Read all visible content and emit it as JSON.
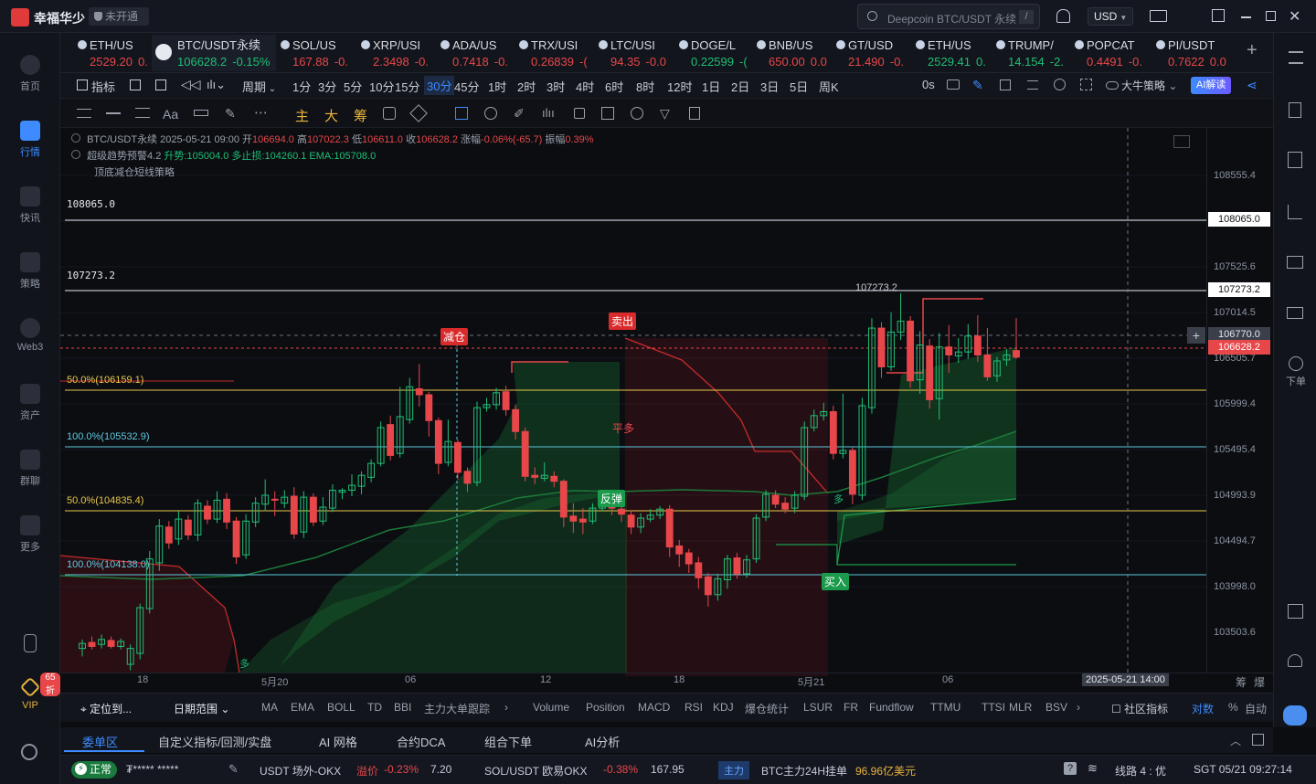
{
  "app": {
    "name": "幸福华少",
    "account_status": "未开通"
  },
  "search": {
    "placeholder": "Deepcoin BTC/USDT 永续"
  },
  "currency": "USD",
  "leftnav": [
    {
      "label": "首页"
    },
    {
      "label": "行情"
    },
    {
      "label": "快讯"
    },
    {
      "label": "策略"
    },
    {
      "label": "Web3"
    },
    {
      "label": "资产"
    },
    {
      "label": "群聊"
    },
    {
      "label": "更多"
    }
  ],
  "vip": {
    "label": "VIP",
    "discount": "65折"
  },
  "rightnav": [
    {
      "label": "下单"
    }
  ],
  "tabs": [
    {
      "symbol": "ETH/US",
      "price": "2529.20",
      "change": "0."
    },
    {
      "symbol": "BTC/USDT永续",
      "price": "106628.2",
      "change": "-0.15%"
    },
    {
      "symbol": "SOL/US",
      "price": "167.88",
      "change": "-0."
    },
    {
      "symbol": "XRP/USI",
      "price": "2.3498",
      "change": "-0."
    },
    {
      "symbol": "ADA/US",
      "price": "0.7418",
      "change": "-0."
    },
    {
      "symbol": "TRX/USI",
      "price": "0.26839",
      "change": "-("
    },
    {
      "symbol": "LTC/USI",
      "price": "94.35",
      "change": "-0.0"
    },
    {
      "symbol": "DOGE/L",
      "price": "0.22599",
      "change": "-("
    },
    {
      "symbol": "BNB/US",
      "price": "650.00",
      "change": "0.0"
    },
    {
      "symbol": "GT/USD",
      "price": "21.490",
      "change": "-0."
    },
    {
      "symbol": "ETH/US",
      "price": "2529.41",
      "change": "0."
    },
    {
      "symbol": "TRUMP/",
      "price": "14.154",
      "change": "-2."
    },
    {
      "symbol": "POPCAT",
      "price": "0.4491",
      "change": "-0."
    },
    {
      "symbol": "PI/USDT",
      "price": "0.7622",
      "change": "0.0"
    }
  ],
  "toolbar1": {
    "indicator": "指标",
    "period": "周期",
    "intervals": [
      "1分",
      "3分",
      "5分",
      "10分",
      "15分",
      "30分",
      "45分",
      "1时",
      "2时",
      "3时",
      "4时",
      "6时",
      "8时",
      "12时",
      "1日",
      "2日",
      "3日",
      "5日",
      "周K"
    ],
    "selected_interval": "30分",
    "countdown": "0s",
    "strategy": "大牛策略",
    "ai": "AI解读"
  },
  "toolbar2": {
    "main": "主",
    "big": "大",
    "chou": "筹"
  },
  "legend": {
    "line1": {
      "symbol": "BTC/USDT永续",
      "time": "2025-05-21 09:00",
      "open_label": "开",
      "open": "106694.0",
      "high_label": "高",
      "high": "107022.3",
      "low_label": "低",
      "low": "106611.0",
      "close_label": "收",
      "close": "106628.2",
      "chg_label": "涨幅",
      "chg": "-0.06%(-65.7)",
      "amp_label": "振幅",
      "amp": "0.39%"
    },
    "line2": {
      "name": "超级趋势预警4.2",
      "trend": "升势:105004.0",
      "stop": "多止损:104260.1",
      "ema": "EMA:105708.0"
    },
    "line3": {
      "name": "顶底减仓短线策略"
    }
  },
  "levels": {
    "l1": "108065.0",
    "l2": "107273.2",
    "fib50a": "50.0%(106159.1)",
    "fib100a": "100.0%(105532.9)",
    "fib50b": "50.0%(104835.4)",
    "fib100b": "100.0%(104138.0)",
    "peak": "107273.2"
  },
  "signals": {
    "reduce": "减仓",
    "sell": "卖出",
    "flat": "平多",
    "rebound": "反弹",
    "buy": "买入",
    "long1": "多",
    "long2": "多"
  },
  "price_axis": {
    "ticks": [
      "108555.4",
      "107525.6",
      "107014.5",
      "106505.7",
      "105999.4",
      "105495.4",
      "104993.9",
      "104494.7",
      "103998.0",
      "103503.6"
    ],
    "box_108065": "108065.0",
    "box_107273": "107273.2",
    "crosshair": "106770.0",
    "last": "106628.2"
  },
  "time_axis": {
    "ticks": [
      "18",
      "5月20",
      "06",
      "12",
      "18",
      "5月21",
      "06"
    ],
    "crosshair": "2025-05-21 14:00",
    "right1": "筹",
    "right2": "爆"
  },
  "indicators_bar": {
    "locate": "定位到...",
    "range": "日期范围",
    "items": [
      "MA",
      "EMA",
      "BOLL",
      "TD",
      "BBI",
      "主力大单跟踪",
      "Volume",
      "Position",
      "MACD",
      "RSI",
      "KDJ",
      "爆仓统计",
      "LSUR",
      "FR",
      "Fundflow",
      "TTMU",
      "TTSI",
      "MLR",
      "BSV"
    ],
    "community": "社区指标",
    "log": "对数",
    "pct": "%",
    "auto": "自动"
  },
  "bottom_tabs": [
    "委单区",
    "自定义指标/回测/实盘",
    "AI 网格",
    "合约DCA",
    "组合下单",
    "AI分析"
  ],
  "status_bar": {
    "state": "正常",
    "masked": "₮***** *****",
    "item1_name": "USDT 场外-OKX",
    "item1_label": "溢价",
    "item1_chg": "-0.23%",
    "item1_val": "7.20",
    "item2_name": "SOL/USDT 欧易OKX",
    "item2_chg": "-0.38%",
    "item2_val": "167.95",
    "zhuli": "主力",
    "zhuli_text": "BTC主力24H挂单",
    "zhuli_val": "96.96亿美元",
    "line": "线路 4 : 优",
    "time": "SGT 05/21 09:27:14"
  },
  "chart_data": {
    "type": "candlestick",
    "ylim": [
      103300,
      108800
    ],
    "candles": [
      [
        103700,
        103750,
        103620,
        103790
      ],
      [
        103760,
        103720,
        103690,
        103820
      ],
      [
        103740,
        103790,
        103700,
        103840
      ],
      [
        103780,
        103720,
        103700,
        103820
      ],
      [
        103720,
        103770,
        103690,
        103800
      ],
      [
        103540,
        103700,
        103480,
        103740
      ],
      [
        103650,
        104110,
        103590,
        104150
      ],
      [
        104100,
        104600,
        104050,
        104680
      ],
      [
        104560,
        104930,
        104480,
        105000
      ],
      [
        104920,
        104760,
        104700,
        104980
      ],
      [
        104800,
        105000,
        104740,
        105080
      ],
      [
        104990,
        104840,
        104790,
        105040
      ],
      [
        104840,
        105160,
        104780,
        105200
      ],
      [
        105130,
        105000,
        104950,
        105190
      ],
      [
        105000,
        105190,
        104960,
        105280
      ],
      [
        105200,
        104970,
        104900,
        105260
      ],
      [
        104980,
        104620,
        104550,
        105020
      ],
      [
        104640,
        104980,
        104600,
        105050
      ],
      [
        104970,
        105160,
        104920,
        105220
      ],
      [
        105150,
        105240,
        105080,
        105400
      ],
      [
        105200,
        105190,
        105030,
        105280
      ],
      [
        105160,
        105220,
        105110,
        105290
      ],
      [
        105230,
        104850,
        104800,
        105320
      ],
      [
        104870,
        105220,
        104810,
        105280
      ],
      [
        105220,
        104970,
        104930,
        105260
      ],
      [
        104980,
        105120,
        104940,
        105220
      ],
      [
        105110,
        105290,
        105070,
        105350
      ],
      [
        105270,
        105290,
        105200,
        105310
      ],
      [
        105290,
        105340,
        105230,
        105450
      ],
      [
        105330,
        105440,
        105250,
        105480
      ],
      [
        105420,
        105560,
        105370,
        105600
      ],
      [
        105560,
        105920,
        105530,
        105980
      ],
      [
        105950,
        105640,
        105590,
        106040
      ],
      [
        105660,
        106030,
        105620,
        106330
      ],
      [
        106000,
        106330,
        105960,
        106420
      ],
      [
        106310,
        106250,
        106130,
        106560
      ],
      [
        106250,
        105990,
        105830,
        106280
      ],
      [
        105990,
        105560,
        105450,
        106020
      ],
      [
        105570,
        105780,
        105530,
        106000
      ],
      [
        105770,
        105470,
        105400,
        105800
      ],
      [
        105480,
        105360,
        105270,
        105520
      ],
      [
        105370,
        106120,
        105330,
        106180
      ],
      [
        106120,
        106150,
        106080,
        106220
      ],
      [
        106150,
        106270,
        106100,
        106320
      ],
      [
        106280,
        106100,
        106040,
        106340
      ],
      [
        106100,
        105880,
        105800,
        106150
      ],
      [
        105880,
        105430,
        105380,
        105920
      ],
      [
        105440,
        105420,
        105350,
        105520
      ],
      [
        105410,
        105440,
        105380,
        105570
      ],
      [
        105430,
        105380,
        105320,
        105480
      ],
      [
        105380,
        105020,
        104920,
        105400
      ],
      [
        105030,
        104980,
        104860,
        105160
      ],
      [
        105000,
        104970,
        104850,
        105110
      ],
      [
        104980,
        105110,
        104950,
        105160
      ],
      [
        105110,
        105160,
        105080,
        105240
      ],
      [
        105150,
        105110,
        105040,
        105200
      ],
      [
        105100,
        105050,
        104970,
        105140
      ],
      [
        105040,
        104920,
        104850,
        105090
      ],
      [
        104920,
        105010,
        104860,
        105060
      ],
      [
        105000,
        105040,
        104970,
        105100
      ],
      [
        105040,
        105100,
        105000,
        105130
      ],
      [
        105100,
        104720,
        104620,
        105140
      ],
      [
        104730,
        104650,
        104520,
        104790
      ],
      [
        104660,
        104550,
        104460,
        104700
      ],
      [
        104560,
        104410,
        104300,
        104620
      ],
      [
        104420,
        104240,
        104120,
        104460
      ],
      [
        104240,
        104400,
        104180,
        104450
      ],
      [
        104390,
        104600,
        104300,
        104640
      ],
      [
        104610,
        104450,
        104400,
        104660
      ],
      [
        104450,
        104590,
        104410,
        104640
      ],
      [
        104600,
        105010,
        104560,
        105050
      ],
      [
        105020,
        105250,
        104980,
        105290
      ],
      [
        105240,
        105150,
        105110,
        105290
      ],
      [
        105160,
        105100,
        105060,
        105220
      ],
      [
        105110,
        105240,
        105060,
        105280
      ],
      [
        105230,
        105920,
        105190,
        105980
      ],
      [
        105920,
        106040,
        105880,
        106100
      ],
      [
        106040,
        106080,
        105990,
        106170
      ],
      [
        106080,
        105660,
        105600,
        106140
      ],
      [
        105660,
        105690,
        105610,
        106260
      ],
      [
        105690,
        105250,
        105150,
        105720
      ],
      [
        105240,
        106140,
        105190,
        106220
      ],
      [
        106120,
        106920,
        106060,
        107020
      ],
      [
        106920,
        106530,
        106420,
        106980
      ],
      [
        106530,
        106880,
        106490,
        107080
      ],
      [
        106880,
        106990,
        106800,
        107270
      ],
      [
        106990,
        106390,
        106320,
        107040
      ],
      [
        106400,
        106750,
        106260,
        106890
      ],
      [
        106740,
        106200,
        106110,
        106810
      ],
      [
        106210,
        106730,
        106000,
        106870
      ],
      [
        106730,
        106650,
        106470,
        106950
      ],
      [
        106640,
        106680,
        106570,
        106820
      ],
      [
        106680,
        106840,
        106610,
        106960
      ],
      [
        106840,
        106650,
        106580,
        107050
      ],
      [
        106650,
        106430,
        106390,
        106920
      ],
      [
        106440,
        106590,
        106380,
        106630
      ],
      [
        106600,
        106650,
        106540,
        106710
      ],
      [
        106694,
        106628,
        106611,
        107022
      ]
    ]
  }
}
